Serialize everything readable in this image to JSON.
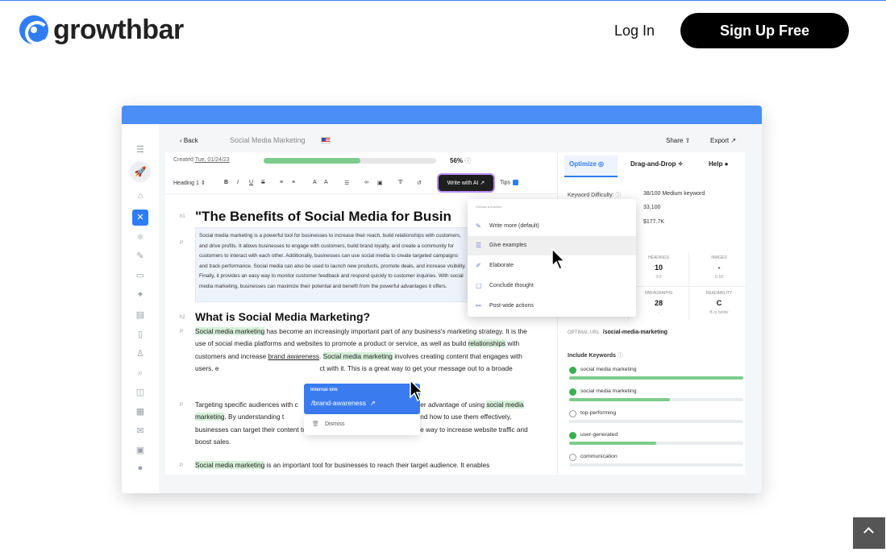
{
  "header": {
    "brand": "growthbar",
    "login_label": "Log In",
    "signup_label": "Sign Up Free"
  },
  "app": {
    "back_label": "Back",
    "document_title": "Social Media Marketing",
    "share_label": "Share",
    "export_label": "Export",
    "created_label": "Created",
    "created_date": "Tue, 01/24/23",
    "progress_percent": 56,
    "progress_label": "56%",
    "toolbar": {
      "heading_select": "Heading 1",
      "bold": "B",
      "italic": "I",
      "underline": "U",
      "strike": "S",
      "write_ai_label": "Write with AI",
      "tips_label": "Tips"
    },
    "gutter": {
      "h1": "h1",
      "p": "P",
      "h2": "h2"
    },
    "h1_text": "\"The Benefits of Social Media for Busin",
    "intro_paragraph": "Social media marketing is a powerful tool for businesses to increase their reach, build relationships with customers, and drive profits. It allows businesses to engage with customers, build brand loyalty, and create a community for customers to interact with each other. Additionally, businesses can use social media to create targeted campaigns and track performance. Social media can also be used to launch new products, promote deals, and increase visibility. Finally, it provides an easy way to monitor customer feedback and respond quickly to customer inquiries. With social media marketing, businesses can maximize their potential and benefit from the powerful advantages it offers.",
    "h2_text": "What is Social Media Marketing?",
    "para2": {
      "a": "Social media marketing",
      "b": " has become an increasingly important part of any business's marketing strategy. It is the use of social media platforms and websites to promote a product or service, as well as build ",
      "c": "relationships",
      "d": " with customers and increase ",
      "e": "brand awareness",
      "f": ". ",
      "g": "Social media marketing",
      "h": " involves creating content that engages with users, e",
      "i": "ct with it. This is a great way to get your message out to a broade"
    },
    "para3": {
      "a": "Targeting specific audiences with c",
      "b": "other advantage of using ",
      "c": "social media marketing",
      "d": ". By understanding t",
      "e": "platforms and how to use them effectively, businesses can target their content to a specific audience. This is an effective way to increase website traffic and boost sales."
    },
    "para4": {
      "a": "Social media marketing",
      "b": " is an important tool for businesses to reach their target audience. It enables"
    },
    "ai_menu": {
      "heading": "Choose a function",
      "items": [
        "Write more (default)",
        "Give examples",
        "Elaborate",
        "Conclude thought",
        "Post-wide actions"
      ],
      "selected": "Give examples"
    },
    "link_popup": {
      "heading": "Internal link",
      "url": "/brand-awareness",
      "dismiss_label": "Dismiss"
    },
    "right_panel": {
      "tabs": [
        "Optimize",
        "Drag-and-Drop",
        "Help"
      ],
      "active_tab": "Optimize",
      "keyword_difficulty_label": "Keyword Difficulty:",
      "keyword_difficulty_value": "38/100 Medium keyword",
      "volume_value": "33,100",
      "cpc_value": "$177.7K",
      "stats": [
        {
          "label": "HEADINGS",
          "value": "10",
          "sub": "3-9"
        },
        {
          "label": "IMAGES",
          "value": "-",
          "sub": "6-18"
        },
        {
          "label": "PARAGRAPHS",
          "value": "28",
          "sub": "-"
        },
        {
          "label": "READABILITY",
          "value": "C",
          "sub": "B or better"
        }
      ],
      "partial_sub": "8-24",
      "optimal_url_label": "OPTIMAL URL",
      "optimal_url_value": "/social-media-marketing",
      "include_keywords_label": "Include Keywords",
      "keywords": [
        {
          "name": "social media marketing",
          "done": true,
          "fill": 1.0
        },
        {
          "name": "social media marketing",
          "done": true,
          "fill": 0.58
        },
        {
          "name": "top-performing",
          "done": false,
          "fill": 0
        },
        {
          "name": "user-generated",
          "done": true,
          "fill": 0.5
        },
        {
          "name": "communication",
          "done": false,
          "fill": 0
        }
      ]
    }
  },
  "colors": {
    "brand_blue": "#2f7df6",
    "signup_bg": "#000000",
    "progress_green": "#7dcc8c",
    "highlight_green": "#d6f0d9"
  }
}
